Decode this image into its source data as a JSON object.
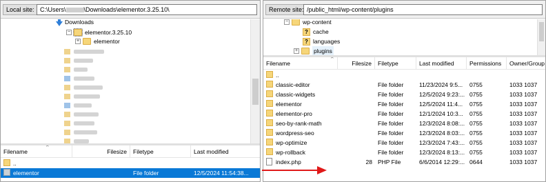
{
  "local": {
    "site_label": "Local site:",
    "path_prefix": "C:\\Users\\",
    "path_suffix": "\\Downloads\\elementor.3.25.10\\",
    "tree": {
      "downloads": "Downloads",
      "elementor_root": "elementor.3.25.10",
      "elementor_child": "elementor",
      "toggle_expanded": "−",
      "toggle_collapsed": "+"
    },
    "list": {
      "headers": {
        "filename": "Filename",
        "filesize": "Filesize",
        "filetype": "Filetype",
        "last_modified": "Last modified"
      },
      "rows": [
        {
          "name": "..",
          "size": "",
          "type": "",
          "modified": ""
        },
        {
          "name": "elementor",
          "size": "",
          "type": "File folder",
          "modified": "12/5/2024 11:54:38..."
        }
      ]
    }
  },
  "remote": {
    "site_label": "Remote site:",
    "path": "/public_html/wp-content/plugins",
    "tree": {
      "wp_content": "wp-content",
      "cache": "cache",
      "languages": "languages",
      "plugins": "plugins",
      "unknown_mark": "?",
      "toggle_expanded": "−",
      "toggle_collapsed": "+"
    },
    "list": {
      "headers": {
        "filename": "Filename",
        "filesize": "Filesize",
        "filetype": "Filetype",
        "last_modified": "Last modified",
        "permissions": "Permissions",
        "owner": "Owner/Group"
      },
      "rows": [
        {
          "name": "..",
          "size": "",
          "type": "",
          "modified": "",
          "perm": "",
          "owner": ""
        },
        {
          "name": "classic-editor",
          "size": "",
          "type": "File folder",
          "modified": "11/23/2024 9:5...",
          "perm": "0755",
          "owner": "1033 1037"
        },
        {
          "name": "classic-widgets",
          "size": "",
          "type": "File folder",
          "modified": "12/5/2024 9:23:...",
          "perm": "0755",
          "owner": "1033 1037"
        },
        {
          "name": "elementor",
          "size": "",
          "type": "File folder",
          "modified": "12/5/2024 11:4...",
          "perm": "0755",
          "owner": "1033 1037"
        },
        {
          "name": "elementor-pro",
          "size": "",
          "type": "File folder",
          "modified": "12/1/2024 10:3...",
          "perm": "0755",
          "owner": "1033 1037"
        },
        {
          "name": "seo-by-rank-math",
          "size": "",
          "type": "File folder",
          "modified": "12/3/2024 8:08:...",
          "perm": "0755",
          "owner": "1033 1037"
        },
        {
          "name": "wordpress-seo",
          "size": "",
          "type": "File folder",
          "modified": "12/3/2024 8:03:...",
          "perm": "0755",
          "owner": "1033 1037"
        },
        {
          "name": "wp-optimize",
          "size": "",
          "type": "File folder",
          "modified": "12/3/2024 7:43:...",
          "perm": "0755",
          "owner": "1033 1037"
        },
        {
          "name": "wp-rollback",
          "size": "",
          "type": "File folder",
          "modified": "12/3/2024 8:13:...",
          "perm": "0755",
          "owner": "1033 1037"
        },
        {
          "name": "index.php",
          "size": "28",
          "type": "PHP File",
          "modified": "6/6/2014 12:29:...",
          "perm": "0644",
          "owner": "1033 1037"
        }
      ]
    }
  },
  "icons": {
    "folder": "folder-icon",
    "file": "file-icon",
    "download_arrow": "download-arrow-icon",
    "transfer_arrow": "red-arrow-icon"
  },
  "colors": {
    "selection": "#0a79d6",
    "folder": "#f6d67a",
    "download_arrow": "#2f7fd8",
    "annotation_arrow": "#e01919"
  }
}
